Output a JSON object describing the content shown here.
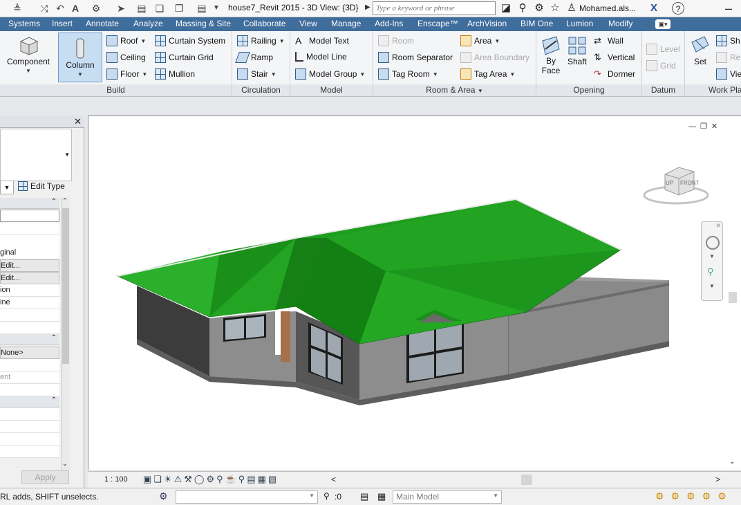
{
  "title_bar": {
    "document_title": "house7_Revit 2015 - 3D View: {3D}",
    "search_placeholder": "Type a keyword or phrase",
    "user_name": "Mohamed.als..."
  },
  "ribbon_tabs": [
    "Systems",
    "Insert",
    "Annotate",
    "Analyze",
    "Massing & Site",
    "Collaborate",
    "View",
    "Manage",
    "Add-Ins",
    "Enscape™",
    "ArchVision",
    "BIM One",
    "Lumion",
    "Modify"
  ],
  "ribbon": {
    "build": {
      "label": "Build",
      "component": "Component",
      "column": "Column",
      "roof": "Roof",
      "ceiling": "Ceiling",
      "floor": "Floor",
      "curtain_system": "Curtain System",
      "curtain_grid": "Curtain Grid",
      "mullion": "Mullion"
    },
    "circulation": {
      "label": "Circulation",
      "railing": "Railing",
      "ramp": "Ramp",
      "stair": "Stair"
    },
    "model": {
      "label": "Model",
      "model_text": "Model Text",
      "model_line": "Model Line",
      "model_group": "Model Group"
    },
    "room_area": {
      "label": "Room & Area",
      "room": "Room",
      "room_separator": "Room Separator",
      "tag_room": "Tag Room",
      "area": "Area",
      "area_boundary": "Area Boundary",
      "tag_area": "Tag Area"
    },
    "opening": {
      "label": "Opening",
      "by_face_1": "By",
      "by_face_2": "Face",
      "shaft": "Shaft",
      "wall": "Wall",
      "vertical": "Vertical",
      "dormer": "Dormer"
    },
    "datum": {
      "label": "Datum",
      "level": "Level",
      "grid": "Grid"
    },
    "work_plane": {
      "label": "Work Pla",
      "set": "Set",
      "show": "Sh",
      "ref": "Re",
      "viewer": "Vie"
    }
  },
  "properties": {
    "edit_type": "Edit Type",
    "rows": [
      "ginal",
      "Edit...",
      "Edit...",
      "ion",
      "ine"
    ],
    "none_value": "None>",
    "ent_value": "ent",
    "apply": "Apply"
  },
  "viewcube": {
    "top": "UP",
    "front": "FRONT"
  },
  "view_bar": {
    "scale": "1 : 100"
  },
  "status_bar": {
    "hint": "RL adds, SHIFT unselects.",
    "count": ":0",
    "workset": "Main Model"
  },
  "colors": {
    "roof": "#1e9e1e",
    "roof_dark": "#137a13",
    "walls": "#8d8d8d",
    "wall_dark": "#4e4e4e",
    "ribbon_tab_bg": "#3f6d9c"
  }
}
